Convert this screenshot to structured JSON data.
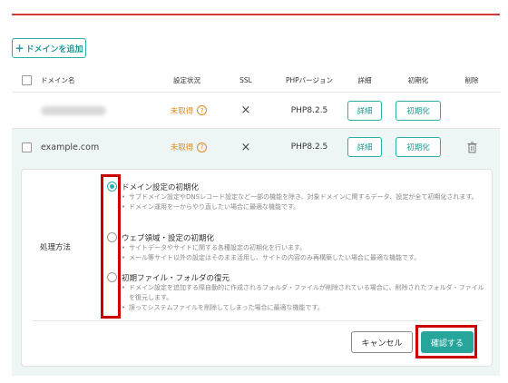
{
  "toolbar": {
    "add_domain_label": "ドメインを追加"
  },
  "table": {
    "headers": {
      "domain": "ドメイン名",
      "status": "設定状況",
      "ssl": "SSL",
      "php": "PHPバージョン",
      "detail": "詳細",
      "reset": "初期化",
      "delete": "削除"
    },
    "rows": [
      {
        "domain": "",
        "status": "未取得",
        "ssl": "×",
        "php": "PHP8.2.5",
        "detail_label": "詳細",
        "reset_label": "初期化"
      },
      {
        "domain": "example.com",
        "status": "未取得",
        "ssl": "×",
        "php": "PHP8.2.5",
        "detail_label": "詳細",
        "reset_label": "初期化"
      }
    ]
  },
  "reset_panel": {
    "method_label": "処理方法",
    "options": [
      {
        "title": "ドメイン設定の初期化",
        "selected": true,
        "desc": [
          "サブドメイン設定やDNSレコード設定など一部の機能を除き、対象ドメインに関するデータ、設定が全て初期化されます。",
          "ドメイン運用を一からやり直したい場合に最適な機能です。"
        ]
      },
      {
        "title": "ウェブ領域・設定の初期化",
        "selected": false,
        "desc": [
          "サイトデータやサイトに関する各種設定の初期化を行います。",
          "メール等サイト以外の設定はそのまま活用し、サイトの内容のみ再構築したい場合に最適な機能です。"
        ]
      },
      {
        "title": "初期ファイル・フォルダの復元",
        "selected": false,
        "desc": [
          "ドメイン設定を追加する際自動的に作成されるフォルダ・ファイルが削除されている場合に、削除されたフォルダ・ファイルを復元します。",
          "誤ってシステムファイルを削除してしまった場合に最適な機能です。"
        ]
      }
    ],
    "cancel_label": "キャンセル",
    "confirm_label": "確認する"
  },
  "colors": {
    "accent": "#26a69a",
    "warning": "#e08a1e",
    "highlight": "#cc0000"
  },
  "icons": {
    "help": "question-circle-icon",
    "trash": "trash-icon",
    "plus": "plus-icon"
  }
}
